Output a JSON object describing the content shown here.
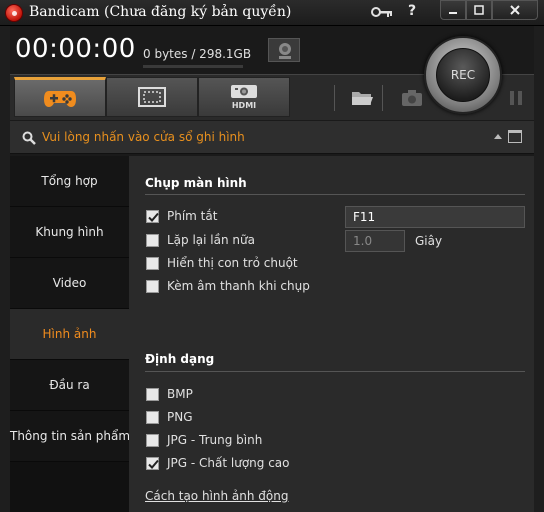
{
  "window": {
    "title": "Bandicam (Chưa đăng ký bản quyền)"
  },
  "top": {
    "timer": "00:00:00",
    "storage": "0 bytes / 298.1GB",
    "rec_label": "REC"
  },
  "toolbar": {
    "tabs": [
      {
        "name": "game-mode",
        "icon": "gamepad-icon",
        "active": true
      },
      {
        "name": "screen-mode",
        "icon": "screen-rect-icon",
        "active": false
      },
      {
        "name": "hdmi-mode",
        "icon": "hdmi-device-icon",
        "active": false
      }
    ],
    "hdmi_label": "HDMI"
  },
  "hint": {
    "text": "Vui lòng nhấn vào cửa sổ ghi hình"
  },
  "sidebar": {
    "items": [
      {
        "label": "Tổng hợp",
        "active": false
      },
      {
        "label": "Khung hình",
        "active": false
      },
      {
        "label": "Video",
        "active": false
      },
      {
        "label": "Hình ảnh",
        "active": true
      },
      {
        "label": "Đầu ra",
        "active": false
      },
      {
        "label": "Thông tin sản phẩm",
        "active": false
      }
    ]
  },
  "capture": {
    "section_title": "Chụp màn hình",
    "hotkey": {
      "label": "Phím tắt",
      "checked": true,
      "value": "F11"
    },
    "repeat": {
      "label": "Lặp lại lần nữa",
      "checked": false,
      "value": "1.0",
      "unit": "Giây"
    },
    "cursor": {
      "label": "Hiển thị con trỏ chuột",
      "checked": false
    },
    "sound": {
      "label": "Kèm âm thanh khi chụp",
      "checked": false
    }
  },
  "format": {
    "section_title": "Định dạng",
    "options": [
      {
        "label": "BMP",
        "checked": false
      },
      {
        "label": "PNG",
        "checked": false
      },
      {
        "label": "JPG - Trung bình",
        "checked": false
      },
      {
        "label": "JPG - Chất lượng cao",
        "checked": true
      }
    ],
    "link": "Cách tạo hình ảnh động"
  },
  "colors": {
    "accent": "#f08c1e",
    "hint": "#e8901e"
  }
}
